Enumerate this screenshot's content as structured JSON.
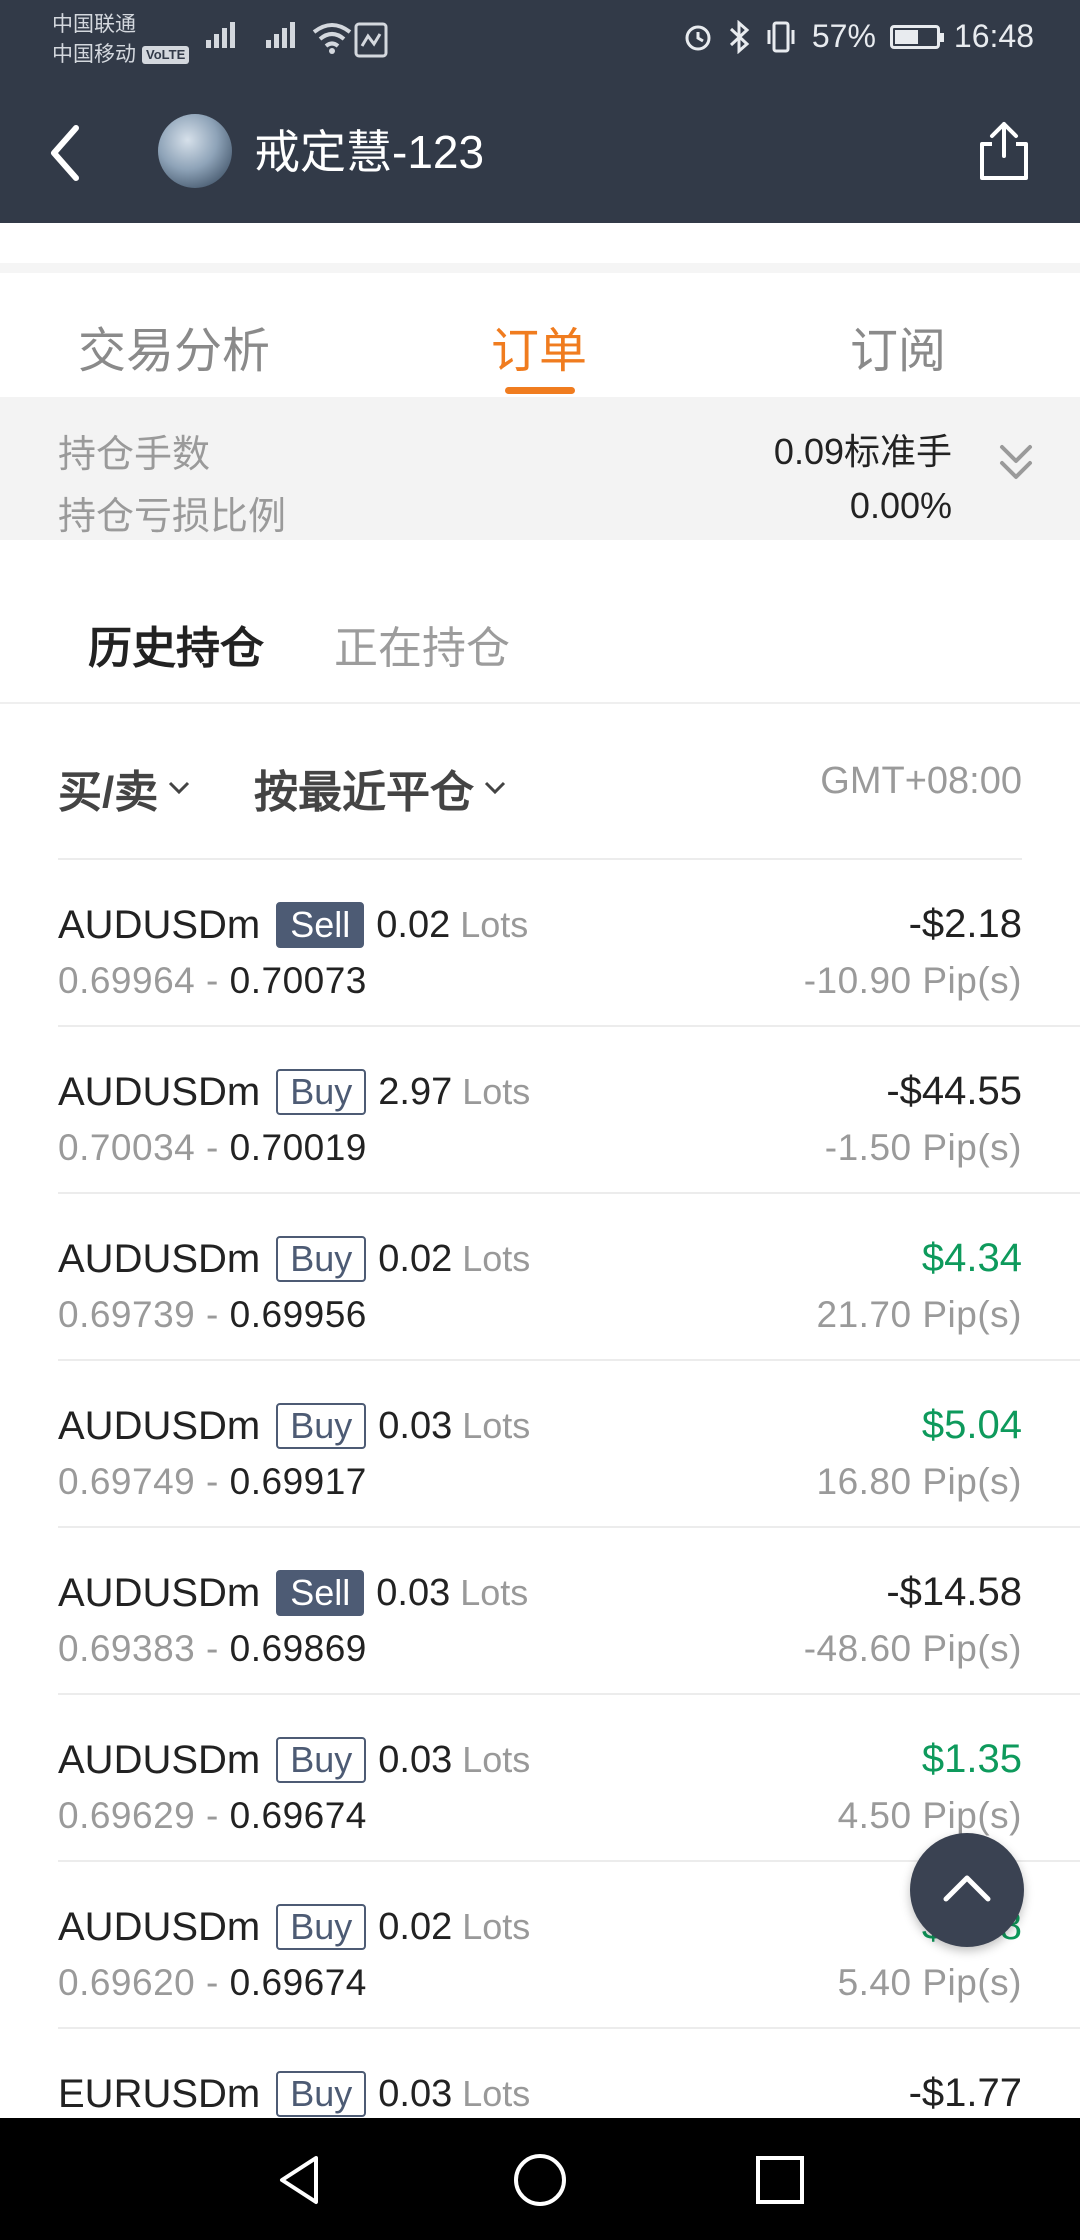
{
  "status_bar": {
    "carrier1": "中国联通",
    "carrier2": "中国移动",
    "volte": "VoLTE",
    "battery": "57%",
    "battery_level": 0.57,
    "time": "16:48"
  },
  "header": {
    "title": "戒定慧-123"
  },
  "tabs": [
    {
      "label": "交易分析",
      "active": false
    },
    {
      "label": "订单",
      "active": true
    },
    {
      "label": "订阅",
      "active": false
    }
  ],
  "summary": {
    "position_lots_label": "持仓手数",
    "position_lots_value": "0.09标准手",
    "position_pl_label": "持仓亏损比例",
    "position_pl_value": "0.00%"
  },
  "subtabs": {
    "history": "历史持仓",
    "current": "正在持仓"
  },
  "filters": {
    "side": "买/卖",
    "sort": "按最近平仓",
    "timezone": "GMT+08:00"
  },
  "orders": [
    {
      "symbol": "AUDUSDm",
      "side": "Sell",
      "lots": "0.02",
      "unit": "Lots",
      "open": "0.69964",
      "sep": "-",
      "close": "0.70073",
      "pnl": "-$2.18",
      "pips": "-10.90 Pip(s)",
      "positive": false
    },
    {
      "symbol": "AUDUSDm",
      "side": "Buy",
      "lots": "2.97",
      "unit": "Lots",
      "open": "0.70034",
      "sep": "-",
      "close": "0.70019",
      "pnl": "-$44.55",
      "pips": "-1.50 Pip(s)",
      "positive": false
    },
    {
      "symbol": "AUDUSDm",
      "side": "Buy",
      "lots": "0.02",
      "unit": "Lots",
      "open": "0.69739",
      "sep": "-",
      "close": "0.69956",
      "pnl": "$4.34",
      "pips": "21.70 Pip(s)",
      "positive": true
    },
    {
      "symbol": "AUDUSDm",
      "side": "Buy",
      "lots": "0.03",
      "unit": "Lots",
      "open": "0.69749",
      "sep": "-",
      "close": "0.69917",
      "pnl": "$5.04",
      "pips": "16.80 Pip(s)",
      "positive": true
    },
    {
      "symbol": "AUDUSDm",
      "side": "Sell",
      "lots": "0.03",
      "unit": "Lots",
      "open": "0.69383",
      "sep": "-",
      "close": "0.69869",
      "pnl": "-$14.58",
      "pips": "-48.60 Pip(s)",
      "positive": false
    },
    {
      "symbol": "AUDUSDm",
      "side": "Buy",
      "lots": "0.03",
      "unit": "Lots",
      "open": "0.69629",
      "sep": "-",
      "close": "0.69674",
      "pnl": "$1.35",
      "pips": "4.50 Pip(s)",
      "positive": true
    },
    {
      "symbol": "AUDUSDm",
      "side": "Buy",
      "lots": "0.02",
      "unit": "Lots",
      "open": "0.69620",
      "sep": "-",
      "close": "0.69674",
      "pnl": "$1.08",
      "pips": "5.40 Pip(s)",
      "positive": true
    },
    {
      "symbol": "EURUSDm",
      "side": "Buy",
      "lots": "0.03",
      "unit": "Lots",
      "open": "",
      "sep": "",
      "close": "",
      "pnl": "-$1.77",
      "pips": "",
      "positive": false
    }
  ],
  "colors": {
    "header_bg": "#323a48",
    "accent": "#f07c1f",
    "profit": "#0e9a5c",
    "badge": "#4d5b74"
  },
  "icons": {
    "back": "back-arrow-icon",
    "share": "share-icon",
    "expand": "double-chevron-down-icon",
    "scroll_top": "chevron-up-icon"
  }
}
